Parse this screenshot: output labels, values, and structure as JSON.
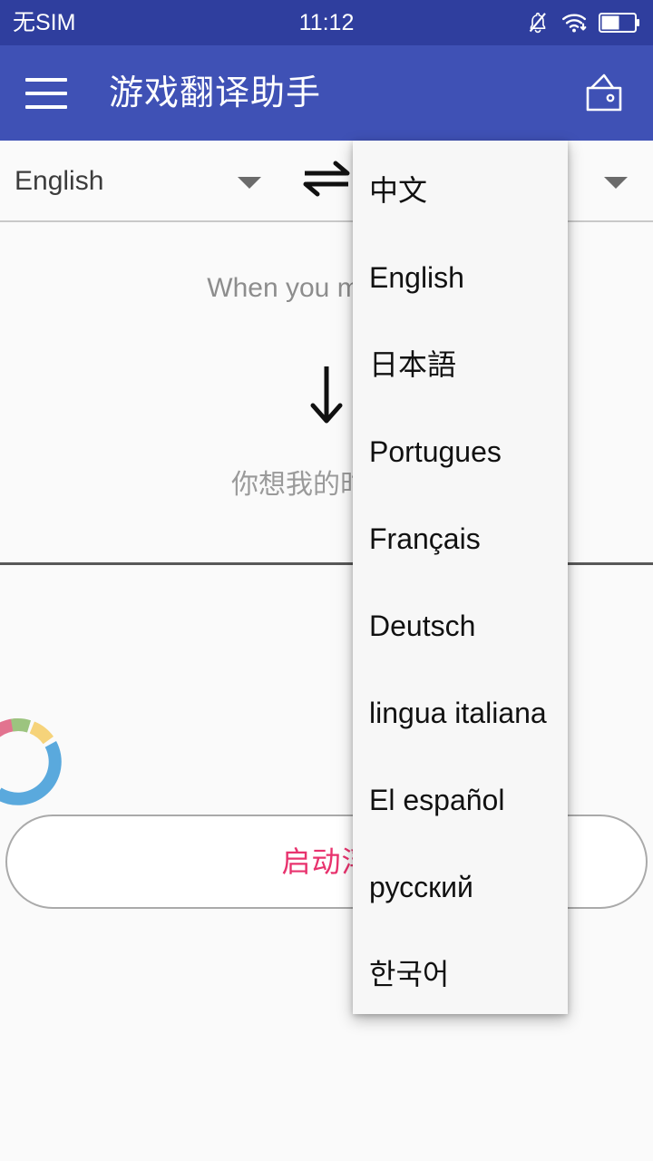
{
  "status_bar": {
    "carrier": "无SIM",
    "clock": "11:12",
    "icons": [
      "bell-muted-icon",
      "wifi-icon",
      "battery-icon"
    ],
    "background": "#2f3e9e",
    "foreground": "#ffffff"
  },
  "app_bar": {
    "menu_icon": "hamburger-menu-icon",
    "title": "游戏翻译助手",
    "action_icon": "wallet-icon",
    "background": "#3f51b5",
    "foreground": "#ffffff"
  },
  "language_bar": {
    "source_language": "English",
    "target_language": "",
    "swap_icon": "swap-horizontal-icon",
    "source_caret_icon": "chevron-down-icon",
    "target_caret_icon": "chevron-down-icon"
  },
  "translation_panel": {
    "source_text": "When you miss me,",
    "arrow_icon": "arrow-down-icon",
    "target_text": "你想我的时候，",
    "source_text_color": "#8d8d8d",
    "target_text_color": "#9a9a9a"
  },
  "spinner": {
    "name": "color-donut-spinner",
    "segments": [
      {
        "name": "pink",
        "color": "#e2738f"
      },
      {
        "name": "green",
        "color": "#9cc47f"
      },
      {
        "name": "yellow",
        "color": "#f6d37a"
      },
      {
        "name": "blue",
        "color": "#5aa9dd"
      }
    ]
  },
  "float_button": {
    "label": "启动浮",
    "label_color": "#e8336e",
    "border_color": "#aaaaaa"
  },
  "dropdown": {
    "visible": true,
    "items": [
      {
        "label": "中文"
      },
      {
        "label": "English"
      },
      {
        "label": "日本語"
      },
      {
        "label": "Portugues"
      },
      {
        "label": "Français"
      },
      {
        "label": "Deutsch"
      },
      {
        "label": "lingua italiana"
      },
      {
        "label": "El español"
      },
      {
        "label": "русский"
      },
      {
        "label": "한국어"
      }
    ],
    "background": "#f7f7f7",
    "text_color": "#111111"
  }
}
